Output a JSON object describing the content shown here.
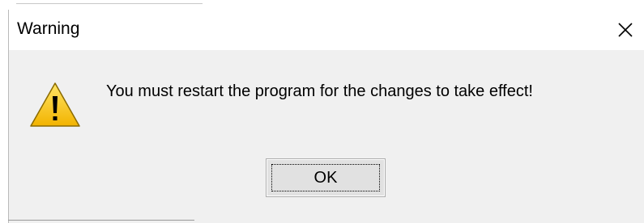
{
  "dialog": {
    "title": "Warning",
    "message": "You must restart the program for the changes to take effect!",
    "icon": "warning-icon",
    "ok_label": "OK",
    "close_icon": "close-icon"
  },
  "colors": {
    "title_bar": "#ffffff",
    "dialog_bg": "#f0f0f0",
    "button_bg": "#e1e1e1",
    "button_border": "#adadad",
    "warning_yellow": "#f5c400",
    "warning_mark": "#000000"
  }
}
